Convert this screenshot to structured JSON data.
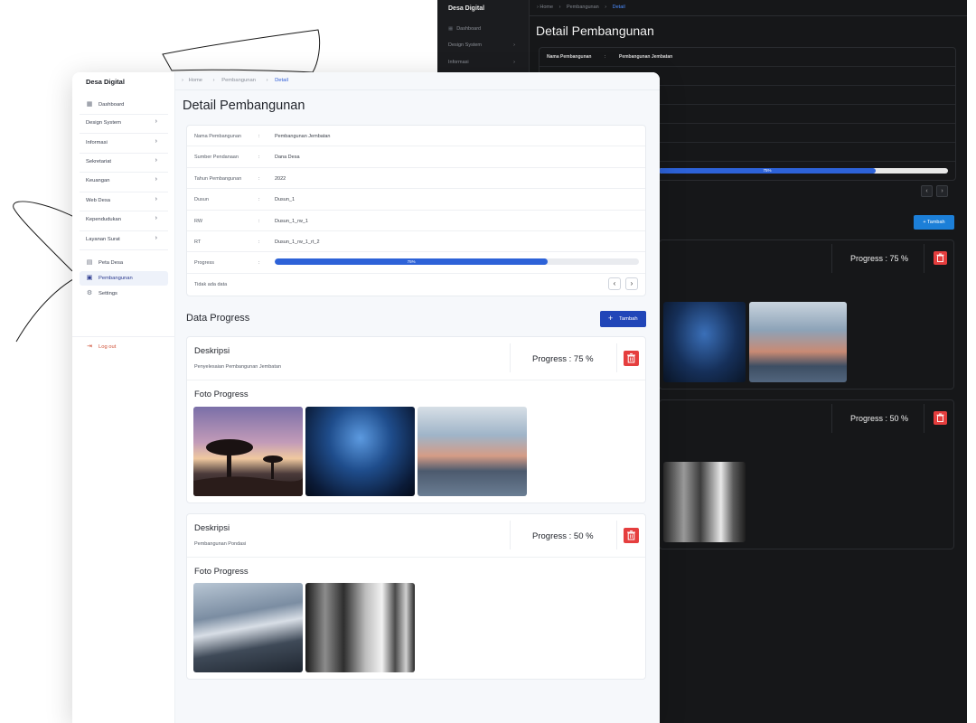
{
  "app": {
    "brand": "Desa Digital"
  },
  "breadcrumb": {
    "home": "Home",
    "section": "Pembangunan",
    "current": "Detail"
  },
  "page_title": "Detail Pembangunan",
  "sidebar": {
    "dashboard": "Dashboard",
    "groups": [
      {
        "label": "Design System"
      },
      {
        "label": "Informasi"
      },
      {
        "label": "Sekretariat"
      },
      {
        "label": "Keuangan"
      },
      {
        "label": "Web Desa"
      },
      {
        "label": "Kependudukan"
      },
      {
        "label": "Layanan Surat"
      }
    ],
    "links": [
      {
        "label": "Peta Desa",
        "icon": "map-icon"
      },
      {
        "label": "Pembangunan",
        "icon": "building-icon",
        "active": true
      },
      {
        "label": "Settings",
        "icon": "gear-icon"
      }
    ],
    "logout": "Log out"
  },
  "detail": {
    "rows": [
      {
        "key": "Nama Pembangunan",
        "value": "Pembangunan Jembatan"
      },
      {
        "key": "Sumber Pendanaan",
        "value": "Dana Desa"
      },
      {
        "key": "Tahun Pembangunan",
        "value": "2022"
      },
      {
        "key": "Dusun",
        "value": "Dusun_1"
      },
      {
        "key": "RW",
        "value": "Dusun_1_rw_1"
      },
      {
        "key": "RT",
        "value": "Dusun_1_rw_1_rt_2"
      }
    ],
    "separator": ":",
    "progress_label": "Progress",
    "progress_value": 75,
    "progress_text": "75%",
    "empty_text": "Tidak ada data"
  },
  "data_progress": {
    "title": "Data Progress",
    "add_button": "Tambah",
    "items": [
      {
        "desc_heading": "Deskripsi",
        "desc_text": "Penyelesaian Pembangunan Jembatan",
        "progress_label": "Progress : 75 %",
        "foto_heading": "Foto Progress"
      },
      {
        "desc_heading": "Deskripsi",
        "desc_text": "Pembangunan Pondasi",
        "progress_label": "Progress : 50 %",
        "foto_heading": "Foto Progress"
      }
    ]
  },
  "dark_preview": {
    "brand": "Desa Digital",
    "breadcrumb": {
      "home": "Home",
      "section": "Pembangunan",
      "current": "Detail"
    },
    "title": "Detail Pembangunan",
    "sidebar": [
      "Dashboard",
      "Design System",
      "Informasi"
    ],
    "row_key": "Nama Pembangunan",
    "row_value": "Pembangunan Jembatan",
    "progress_text": "75%",
    "add_button": "Tambah",
    "progress_1": "Progress : 75 %",
    "progress_2": "Progress : 50 %"
  },
  "colors": {
    "primary": "#2146b8",
    "progress_fill": "#2d62d8",
    "danger": "#e53e3e",
    "dark_bg": "#161719",
    "accent_dark_button": "#1c7fd8"
  }
}
